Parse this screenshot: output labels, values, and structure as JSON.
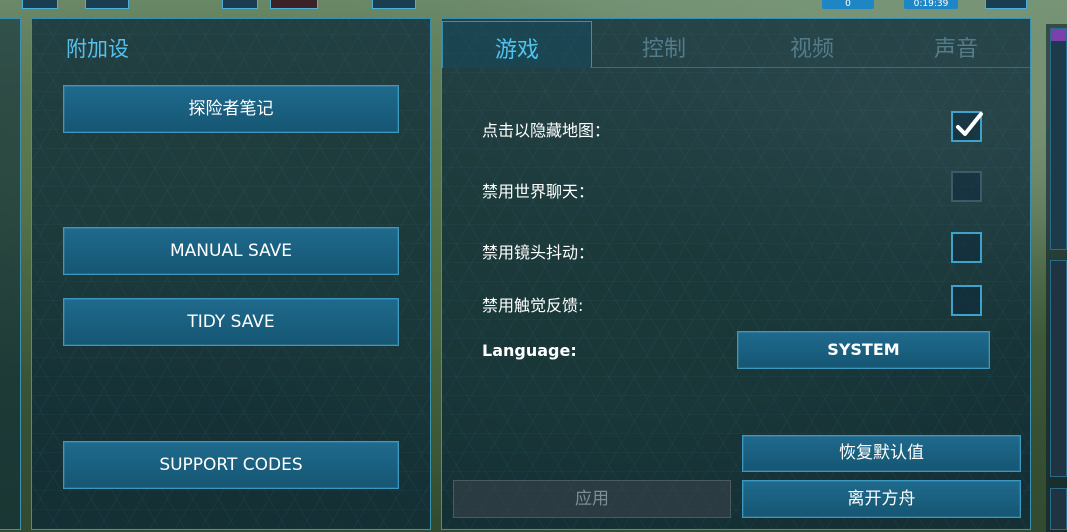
{
  "hud": {
    "counter_left": "0",
    "counter_time": "0:19:39"
  },
  "left_panel": {
    "title": "附加设",
    "explorer_notes": "探险者笔记",
    "manual_save": "MANUAL SAVE",
    "tidy_save": "TIDY SAVE",
    "support_codes": "SUPPORT CODES"
  },
  "tabs": [
    {
      "label": "游戏",
      "active": true
    },
    {
      "label": "控制",
      "active": false
    },
    {
      "label": "视频",
      "active": false
    },
    {
      "label": "声音",
      "active": false
    }
  ],
  "settings": {
    "hide_map": {
      "label": "点击以隐藏地图：",
      "checked": true
    },
    "disable_chat": {
      "label": "禁用世界聊天：",
      "checked": false
    },
    "disable_shake": {
      "label": "禁用镜头抖动：",
      "checked": false
    },
    "disable_haptics": {
      "label": "禁用触觉反馈:",
      "checked": false
    },
    "language": {
      "label": "Language:",
      "value": "SYSTEM"
    }
  },
  "actions": {
    "reset": "恢复默认值",
    "apply": "应用",
    "leave": "离开方舟"
  },
  "colors": {
    "accent": "#4fc2ee",
    "button": "#1f6a8d",
    "panel": "#082638"
  }
}
